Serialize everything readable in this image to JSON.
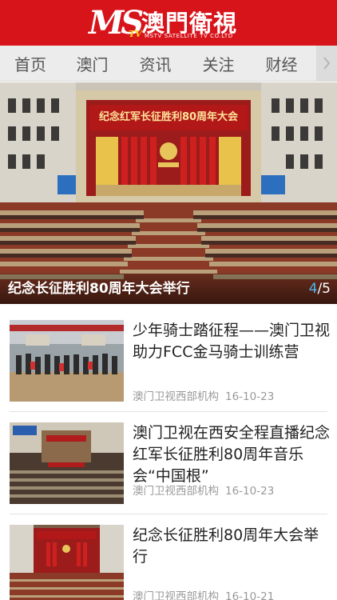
{
  "header": {
    "logo_ms": "MS",
    "logo_tv": "TV",
    "logo_name": "澳門衛視",
    "logo_sub": "MSTV SATELLITE TV CO.LTD"
  },
  "nav": {
    "items": [
      "首页",
      "澳门",
      "资讯",
      "关注",
      "财经"
    ],
    "more_icon": "chevron-right-icon"
  },
  "hero": {
    "banner_text": "纪念红军长征胜利80周年大会",
    "title": "纪念长征胜利80周年大会举行",
    "pager_current": "4",
    "pager_total": "/5"
  },
  "feed": [
    {
      "title": "少年骑士踏征程——澳门卫视助力FCC金马骑士训练营",
      "source": "澳门卫视西部机构",
      "date": "16-10-23"
    },
    {
      "title": "澳门卫视在西安全程直播纪念红军长征胜利80周年音乐会“中国根”",
      "source": "澳门卫视西部机构",
      "date": "16-10-23"
    },
    {
      "title": "纪念长征胜利80周年大会举行",
      "source": "澳门卫视西部机构",
      "date": "16-10-21"
    }
  ],
  "colors": {
    "brand_red": "#d8141b",
    "pager_accent": "#4fb8ea"
  }
}
